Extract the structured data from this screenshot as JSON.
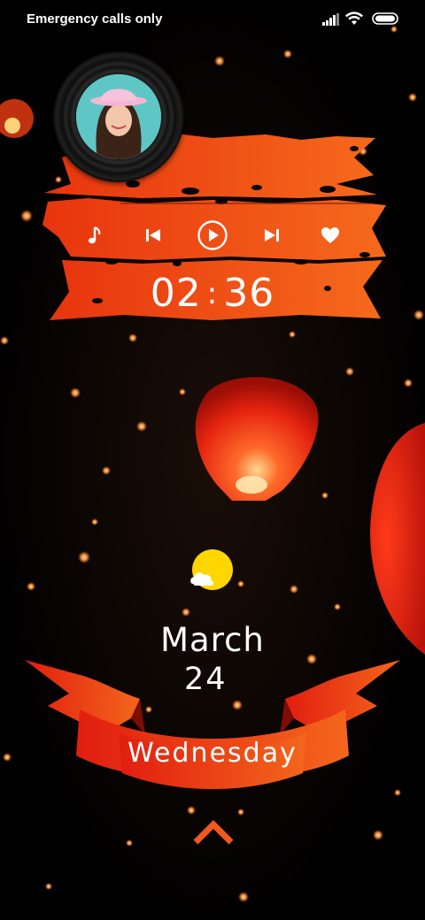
{
  "status_bar": {
    "carrier_text": "Emergency calls only",
    "icons": [
      "signal-icon",
      "wifi-icon",
      "battery-icon"
    ]
  },
  "music_player": {
    "icons": [
      "music-note-icon",
      "previous-icon",
      "play-icon",
      "next-icon",
      "heart-icon"
    ],
    "elapsed_minutes": "02",
    "separator": ":",
    "elapsed_seconds": "36",
    "accent_color": "#f0501a"
  },
  "weather": {
    "icon": "partly-sunny-icon",
    "sun_color": "#ffd600"
  },
  "date": {
    "month": "March",
    "day": "24",
    "weekday": "Wednesday"
  },
  "unlock": {
    "icon": "chevron-up-icon",
    "color": "#f4581c"
  }
}
